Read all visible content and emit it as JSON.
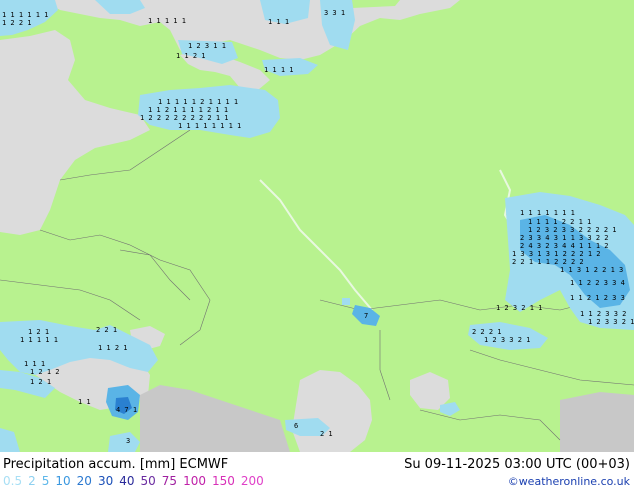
{
  "title": "Precipitation accum. [mm] ECMWF",
  "valid_time": "Su 09-11-2025 03:00 UTC (00+03)",
  "credit": "©weatheronline.co.uk",
  "colors": {
    "land": "#b8f28f",
    "sea": "#dcdcdc",
    "outside": "#c8c8c8",
    "precip_light": "#a0dcf0",
    "precip_mid": "#5ab4e6",
    "precip_heavy": "#2a80d0"
  },
  "legend": [
    {
      "label": "0.5",
      "color": "#a8dff5"
    },
    {
      "label": "2",
      "color": "#8ed0f0"
    },
    {
      "label": "5",
      "color": "#5fb8ea"
    },
    {
      "label": "10",
      "color": "#3a98e0"
    },
    {
      "label": "20",
      "color": "#2a78d0"
    },
    {
      "label": "30",
      "color": "#1a4fb8"
    },
    {
      "label": "40",
      "color": "#2a2a9a"
    },
    {
      "label": "50",
      "color": "#6a2aa0"
    },
    {
      "label": "75",
      "color": "#a020a0"
    },
    {
      "label": "100",
      "color": "#c020a8"
    },
    {
      "label": "150",
      "color": "#d830b8"
    },
    {
      "label": "200",
      "color": "#e040c8"
    }
  ],
  "grid_labels": [
    "1 1 1 1  1 1",
    "1 2 2 1",
    "1 1 1 1 1",
    "1 1 1",
    "3 3 1",
    "1 2 3 1 1",
    "1 1 2 1",
    "1 1 1 1",
    "1 1 1 1 1 2 1 1 1 1",
    "1 1 2 1 1 1 1 2 1 1",
    "1 2 2 2 2 2 2 2 2 1 1",
    "1 1 1 1 1 1 1 1",
    "1 1 1 1 1 1 1",
    "1 1 1 1 2 2 1 1",
    "1 2 3 2 3 3 2 2 2 2 1",
    "2 3 3 4 3 1 1 3 3 2 2",
    "2 4 3 2 3 4 4 1 1 1 2",
    "1 3 3 1 3 1 2 2 2 1 2",
    "2 2 1  1 1 2 2 2 2",
    "1 1 3 1 2 2 1 3",
    "1 1 2 2 3 3 4",
    "1 1 2 1 2 3 3",
    "1 2 3 2 1 1",
    "1 1 2 3 3 2",
    "1 2 3 3 2 1",
    "2 2 2 1",
    "1 2 3 3 2 1",
    "1 2 1",
    "1 1 1 1 1",
    "2 2 1",
    "1 1 2 1",
    "1 1 1",
    "1 2 1 2",
    "1 2 1",
    "1 1",
    "4 7 1",
    "3",
    "7",
    "6",
    "2 1"
  ]
}
